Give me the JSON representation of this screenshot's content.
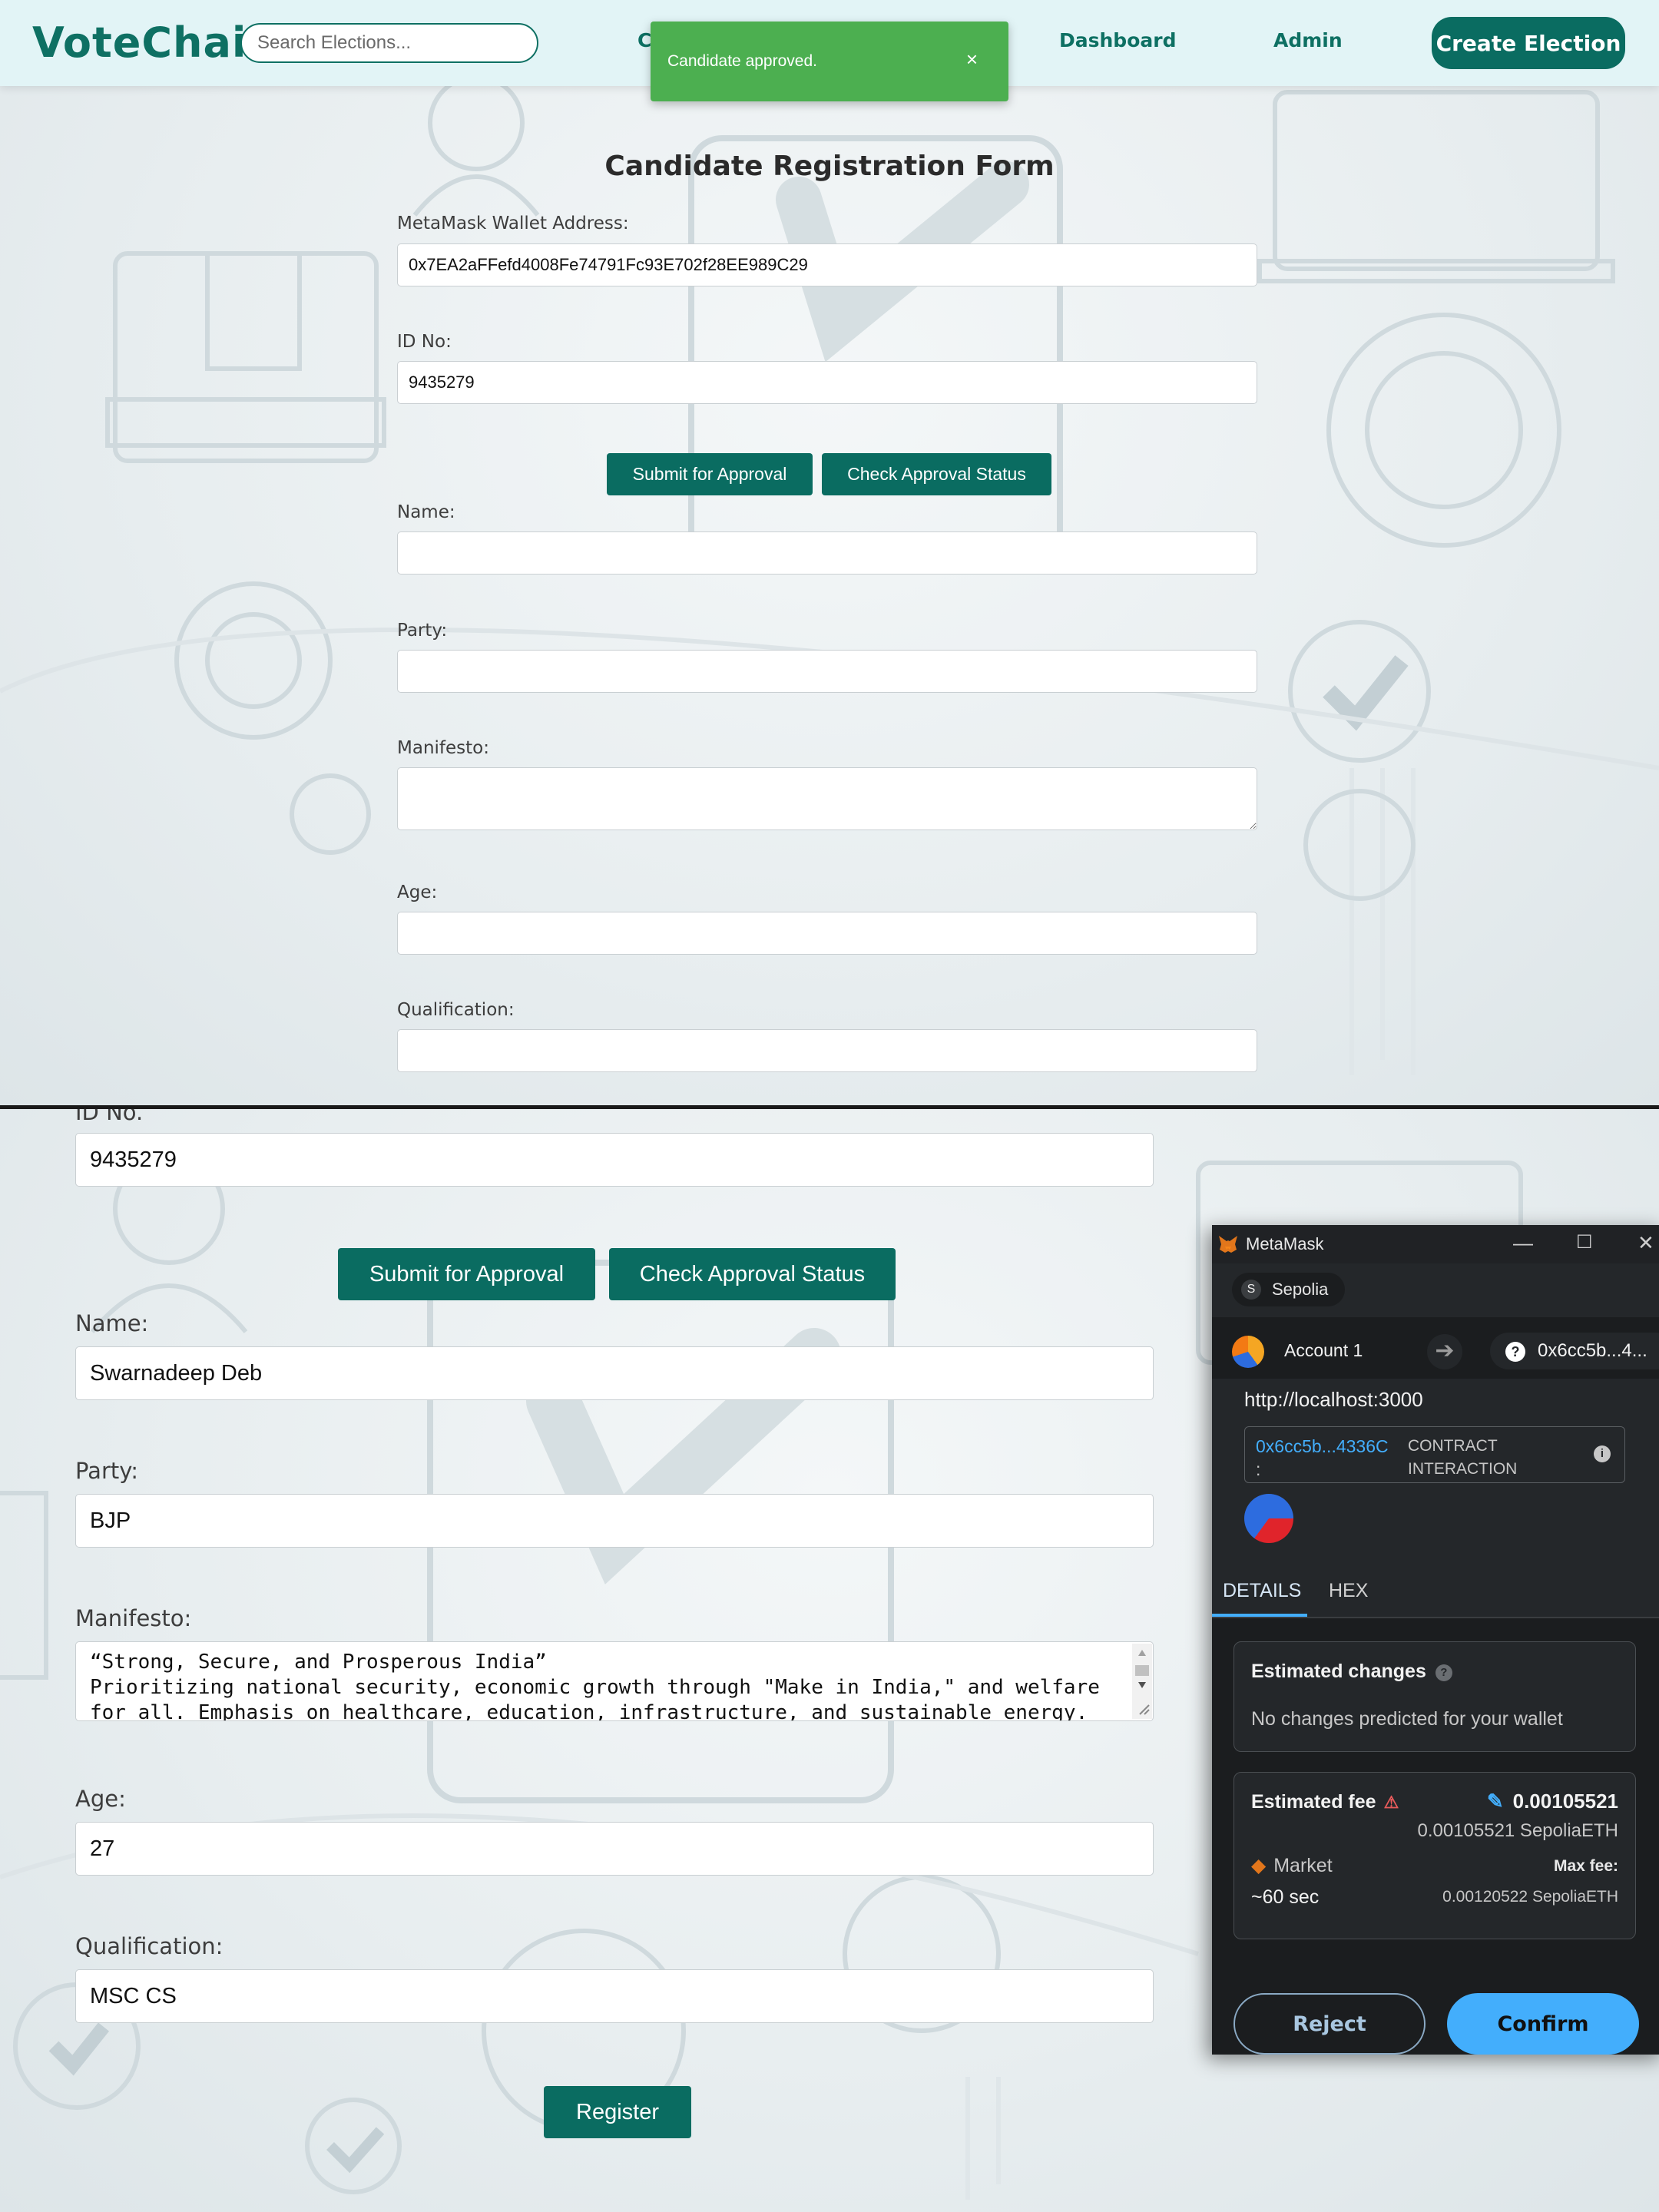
{
  "app": {
    "logo": "VoteChain",
    "search_placeholder": "Search Elections...",
    "nav_partial": "C",
    "nav": {
      "dashboard": "Dashboard",
      "admin": "Admin"
    },
    "create_election": "Create Election"
  },
  "toast": {
    "message": "Candidate approved.",
    "close": "×",
    "color": "#4caf50"
  },
  "form_top": {
    "title": "Candidate Registration Form",
    "wallet_label": "MetaMask Wallet Address:",
    "wallet_value": "0x7EA2aFFefd4008Fe74791Fc93E702f28EE989C29",
    "id_label": "ID No:",
    "id_value": "9435279",
    "submit_label": "Submit for Approval",
    "check_label": "Check Approval Status",
    "name_label": "Name:",
    "party_label": "Party:",
    "manifesto_label": "Manifesto:",
    "age_label": "Age:",
    "qualification_label": "Qualification:"
  },
  "form_bottom": {
    "id_label": "ID No.",
    "id_value": "9435279",
    "submit_label": "Submit for Approval",
    "check_label": "Check Approval Status",
    "name_label": "Name:",
    "name_value": "Swarnadeep Deb",
    "party_label": "Party:",
    "party_value": "BJP",
    "manifesto_label": "Manifesto:",
    "manifesto_value": "“Strong, Secure, and Prosperous India”\nPrioritizing national security, economic growth through \"Make in India,\" and welfare for all. Emphasis on healthcare, education, infrastructure, and sustainable energy.",
    "age_label": "Age:",
    "age_value": "27",
    "qualification_label": "Qualification:",
    "qualification_value": "MSC CS",
    "register_label": "Register"
  },
  "metamask": {
    "title": "MetaMask",
    "network": "Sepolia",
    "network_initial": "S",
    "account": "Account 1",
    "to_address": "0x6cc5b...4...",
    "origin": "http://localhost:3000",
    "contract_address": "0x6cc5b...4336C",
    "contract_suffix": ":",
    "contract_kind_1": "CONTRACT",
    "contract_kind_2": "INTERACTION",
    "tabs": {
      "details": "DETAILS",
      "hex": "HEX"
    },
    "estimated_changes_title": "Estimated changes",
    "estimated_changes_text": "No changes predicted for your wallet",
    "estimated_fee_title": "Estimated fee",
    "fee_value": "0.00105521",
    "fee_eth": "0.00105521 SepoliaETH",
    "market_label": "Market",
    "time_label": "~60 sec",
    "max_fee_label": "Max fee:",
    "max_fee_value": "0.00120522 SepoliaETH",
    "reject_label": "Reject",
    "confirm_label": "Confirm",
    "accent": "#43aefc"
  },
  "colors": {
    "brand": "#0a6c61",
    "brand_text": "#0e7063"
  }
}
